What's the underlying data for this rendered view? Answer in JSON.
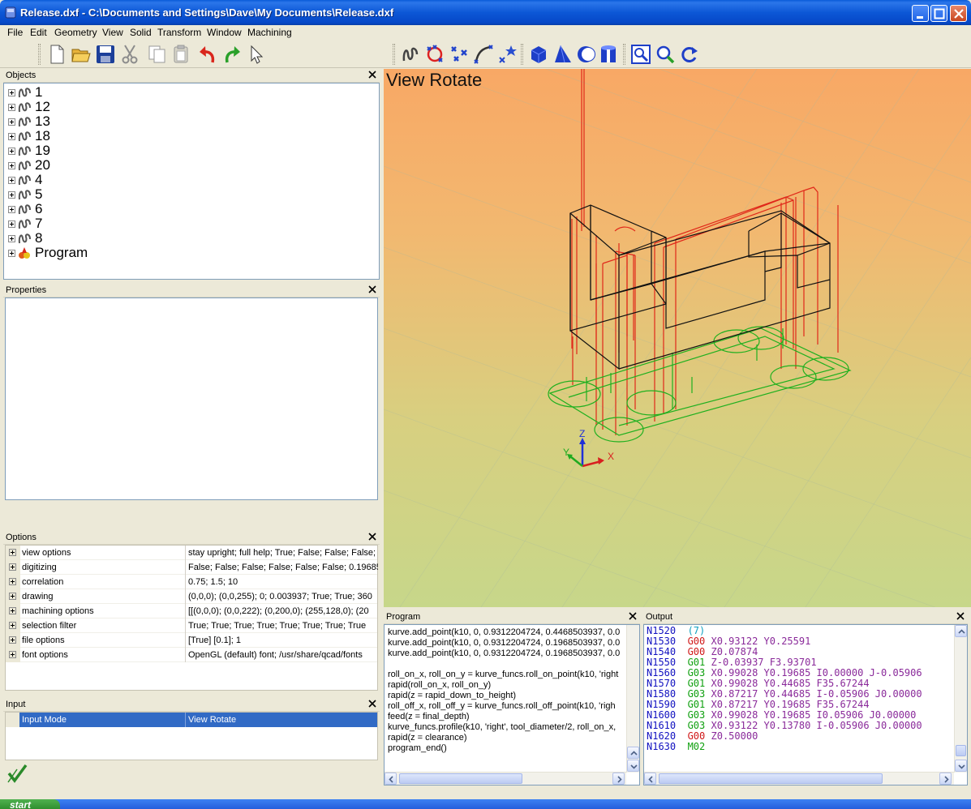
{
  "window": {
    "title": "Release.dxf - C:\\Documents and Settings\\Dave\\My Documents\\Release.dxf"
  },
  "menu": [
    "File",
    "Edit",
    "Geometry",
    "View",
    "Solid",
    "Transform",
    "Window",
    "Machining"
  ],
  "toolbar": {
    "file_icons": [
      "new-file-icon",
      "open-folder-icon",
      "save-icon",
      "cut-icon",
      "copy-icon",
      "paste-icon",
      "undo-icon",
      "redo-icon",
      "select-arrow-icon"
    ],
    "geometry_icons": [
      "sketch-icon",
      "circle-points-icon",
      "points-icon",
      "arc-icon",
      "star-points-icon"
    ],
    "solid_icons": [
      "cube-icon",
      "cone-icon",
      "sphere-icon",
      "cylinder-icon"
    ],
    "view_icons": [
      "zoom-window-icon",
      "zoom-icon",
      "rotate-view-icon"
    ]
  },
  "objects": {
    "title": "Objects",
    "items": [
      "1",
      "12",
      "13",
      "18",
      "19",
      "20",
      "4",
      "5",
      "6",
      "7",
      "8",
      "Program"
    ]
  },
  "properties": {
    "title": "Properties"
  },
  "options": {
    "title": "Options",
    "rows": [
      {
        "name": "view options",
        "value": "stay upright; full help; True; False; False; False;"
      },
      {
        "name": "digitizing",
        "value": "False; False; False; False; False; False; 0.19685"
      },
      {
        "name": "correlation",
        "value": "0.75; 1.5; 10"
      },
      {
        "name": "drawing",
        "value": "(0,0,0); (0,0,255); 0; 0.003937; True; True; 360"
      },
      {
        "name": "machining options",
        "value": "[[(0,0,0); (0,0,222); (0,200,0); (255,128,0); (20"
      },
      {
        "name": "selection filter",
        "value": "True; True; True; True; True; True; True; True"
      },
      {
        "name": "file options",
        "value": "[True] [0.1]; 1"
      },
      {
        "name": "font options",
        "value": "OpenGL (default) font; /usr/share/qcad/fonts"
      }
    ]
  },
  "input": {
    "title": "Input",
    "name": "Input Mode",
    "value": "View Rotate"
  },
  "viewport": {
    "label": "View Rotate",
    "axes": {
      "x": "X",
      "y": "Y",
      "z": "Z"
    },
    "colors": {
      "solid": "#111111",
      "toolpath": "#e0281a",
      "profile": "#1fb01f"
    }
  },
  "program": {
    "title": "Program",
    "lines": [
      "kurve.add_point(k10, 0, 0.9312204724, 0.4468503937, 0.0",
      "kurve.add_point(k10, 0, 0.9312204724, 0.1968503937, 0.0",
      "kurve.add_point(k10, 0, 0.9312204724, 0.1968503937, 0.0",
      "",
      "roll_on_x, roll_on_y = kurve_funcs.roll_on_point(k10, 'right",
      "rapid(roll_on_x, roll_on_y)",
      "rapid(z = rapid_down_to_height)",
      "roll_off_x, roll_off_y = kurve_funcs.roll_off_point(k10, 'righ",
      "feed(z = final_depth)",
      "kurve_funcs.profile(k10, 'right', tool_diameter/2, roll_on_x,",
      "rapid(z = clearance)",
      "program_end()"
    ]
  },
  "output": {
    "title": "Output",
    "lines": [
      {
        "n": "N1520",
        "cmd": "",
        "args": "(7)",
        "comment": true
      },
      {
        "n": "N1530",
        "cmd": "G00",
        "args": "X0.93122 Y0.25591"
      },
      {
        "n": "N1540",
        "cmd": "G00",
        "args": "Z0.07874"
      },
      {
        "n": "N1550",
        "cmd": "G01",
        "args": "Z-0.03937 F3.93701"
      },
      {
        "n": "N1560",
        "cmd": "G03",
        "args": "X0.99028 Y0.19685 I0.00000 J-0.05906"
      },
      {
        "n": "N1570",
        "cmd": "G01",
        "args": "X0.99028 Y0.44685 F35.67244"
      },
      {
        "n": "N1580",
        "cmd": "G03",
        "args": "X0.87217 Y0.44685 I-0.05906 J0.00000"
      },
      {
        "n": "N1590",
        "cmd": "G01",
        "args": "X0.87217 Y0.19685 F35.67244"
      },
      {
        "n": "N1600",
        "cmd": "G03",
        "args": "X0.99028 Y0.19685 I0.05906 J0.00000"
      },
      {
        "n": "N1610",
        "cmd": "G03",
        "args": "X0.93122 Y0.13780 I-0.05906 J0.00000"
      },
      {
        "n": "N1620",
        "cmd": "G00",
        "args": "Z0.50000"
      },
      {
        "n": "N1630",
        "cmd": "M02",
        "args": ""
      }
    ]
  },
  "taskbar": {
    "start_label": "start"
  },
  "colors": {
    "g00": "#d01818",
    "g01": "#10a010",
    "g03": "#10a010",
    "args": "#8a2a9a",
    "line_number": "#1010c0",
    "comment": "#10a0c0"
  }
}
